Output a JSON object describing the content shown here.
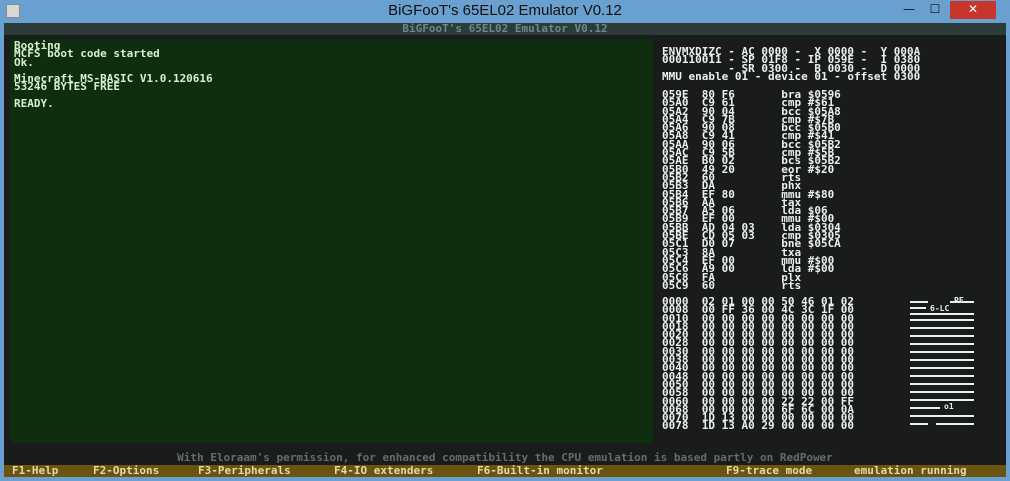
{
  "window": {
    "title": "BiGFooT's 65EL02 Emulator V0.12",
    "inner_title": "BiGFooT's 65EL02 Emulator V0.12",
    "controls": {
      "minimize": "—",
      "maximize": "☐",
      "close": "✕"
    }
  },
  "screen": {
    "lines": [
      "Booting",
      "MCFS boot code started",
      "Ok.",
      "",
      "Minecraft MS-BASIC V1.0.120616",
      "53246 BYTES FREE",
      "",
      "READY."
    ]
  },
  "registers": {
    "lines": [
      "ENVMXDIZC - AC 0000 -  X 0000 -  Y 000A",
      "000110011 - SP 01F8 - IP 059E -  I 0380",
      "          - SR 0300 -  B 0030 -  D 0000",
      "MMU enable 01 - device 01 - offset 0300"
    ]
  },
  "disassembly": {
    "lines": [
      "059E  80 F6       bra $0596",
      "05A0  C9 61       cmp #$61",
      "05A2  90 04       bcc $05A8",
      "05A4  C9 7B       cmp #$7B",
      "05A6  90 08       bcc $05B0",
      "05A8  C9 41       cmp #$41",
      "05AA  90 06       bcc $05B2",
      "05AC  C9 5B       cmp #$5B",
      "05AE  B0 02       bcs $05B2",
      "05B0  49 20       eor #$20",
      "05B2  60          rts",
      "05B3  DA          phx",
      "05B4  EF 80       mmu #$80",
      "05B6  AA          tax",
      "05B7  A5 06       lda $06",
      "05B9  EF 00       mmu #$00",
      "05BB  AD 04 03    lda $0304",
      "05BE  CD 05 03    cmp $0305",
      "05C1  D0 07       bne $05CA",
      "05C3  8A          txa",
      "05C4  EF 00       mmu #$00",
      "05C6  A9 00       lda #$00",
      "05C8  FA          plx",
      "05C9  60          rts"
    ]
  },
  "memory": {
    "lines": [
      "0000  02 01 00 00 50 46 01 02",
      "0008  00 FF 36 00 4C 3C 1F 00",
      "0010  00 00 00 00 00 00 00 00",
      "0018  00 00 00 00 00 00 00 00",
      "0020  00 00 00 00 00 00 00 00",
      "0028  00 00 00 00 00 00 00 00",
      "0030  00 00 00 00 00 00 00 00",
      "0038  00 00 00 00 00 00 00 00",
      "0040  00 00 00 00 00 00 00 00",
      "0048  00 00 00 00 00 00 00 00",
      "0050  00 00 00 00 00 00 00 00",
      "0058  00 00 00 00 00 00 00 00",
      "0060  00 00 00 00 22 22 00 FF",
      "0068  00 00 00 00 6F 6C 00 0A",
      "0070  1D 13 00 00 00 00 00 00",
      "0078  1D 13 A0 29 00 00 00 00"
    ]
  },
  "io_panel": {
    "label_pf": "PF",
    "label_6lc": "6-LC",
    "label_o1": "o1"
  },
  "credit": "With Eloraam's permission, for enhanced compatibility the CPU emulation is based partly on RedPower",
  "function_keys": [
    "F1-Help",
    "F2-Options",
    "F3-Peripherals",
    "F4-IO extenders",
    "F6-Built-in monitor",
    "F9-trace mode",
    "emulation running"
  ]
}
